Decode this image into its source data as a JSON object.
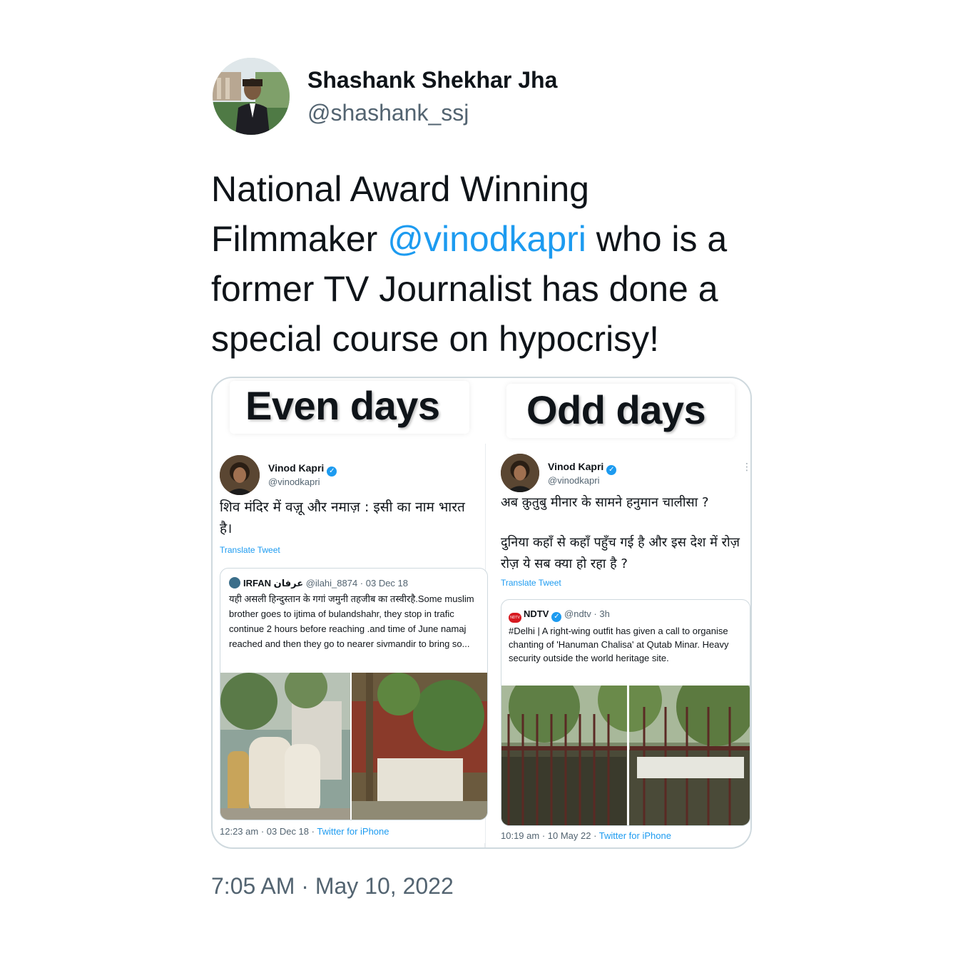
{
  "author": {
    "name": "Shashank Shekhar Jha",
    "handle": "@shashank_ssj"
  },
  "tweet": {
    "text_before": "National Award Winning Filmmaker ",
    "mention": "@vinodkapri",
    "text_after": " who is a former TV Journalist has done a special course on hypocrisy!",
    "timestamp": "7:05 AM · May 10, 2022"
  },
  "media": {
    "left_header": "Even days",
    "right_header": "Odd days",
    "left": {
      "name": "Vinod Kapri",
      "handle": "@vinodkapri",
      "text": "शिव मंदिर में वज़ू और नमाज़ : इसी का नाम भारत है।",
      "translate": "Translate Tweet",
      "quote": {
        "name": "IRFAN عرفان",
        "meta": "@ilahi_8874 · 03 Dec 18",
        "body": "यही असली हिन्दुस्तान के गगां जमुनी तहजीब का तस्वीरहै.Some muslim brother goes to ijtima of bulandshahr,  they stop in trafic continue 2 hours before reaching .and time of June namaj reached and then they go to nearer sivmandir to bring so..."
      },
      "time": "12:23 am · 03 Dec 18 · ",
      "source": "Twitter for iPhone"
    },
    "right": {
      "name": "Vinod Kapri",
      "handle": "@vinodkapri",
      "text1": "अब क़ुतुबु मीनार के सामने हनुमान चालीसा ?",
      "text2": "दुनिया कहाँ से कहाँ पहुँच गई है और इस देश में रोज़ रोज़ ये सब क्या हो रहा है  ?",
      "translate": "Translate Tweet",
      "quote": {
        "logo": "NDTV",
        "name": "NDTV",
        "meta": "@ndtv · 3h",
        "body": "#Delhi | A right-wing outfit has given a call to organise chanting of 'Hanuman Chalisa' at Qutab Minar. Heavy security outside the world heritage site."
      },
      "time": "10:19 am · 10 May 22 · ",
      "source": "Twitter for iPhone"
    }
  },
  "colors": {
    "link": "#1d9bf0",
    "text": "#0f1419",
    "muted": "#536471",
    "border": "#cfd9de"
  },
  "icons": [
    "verified-badge-icon",
    "more-options-icon"
  ]
}
